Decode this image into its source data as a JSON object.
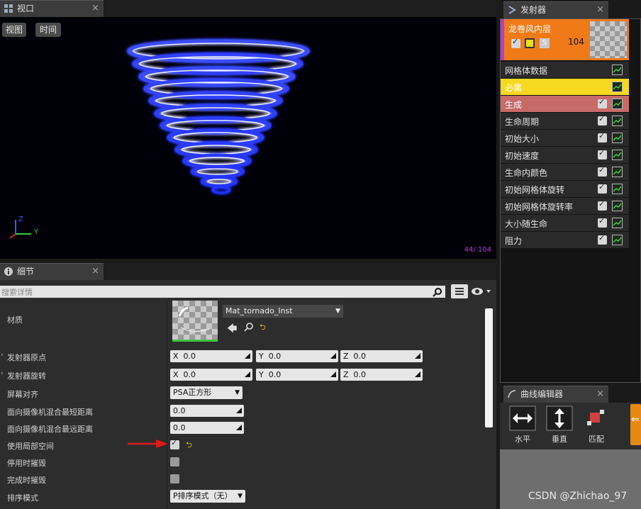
{
  "viewport": {
    "tab_label": "视口",
    "btn_view": "视图",
    "btn_time": "时间",
    "axis_z": "Z",
    "axis_y": "Y",
    "counter": "44/ 104"
  },
  "details": {
    "tab_label": "细节",
    "search_placeholder": "搜索详情",
    "material_label": "材质",
    "material_value": "Mat_tornado_Inst",
    "rows": {
      "origin": "发射器原点",
      "rotation": "发射器旋转",
      "screen_align": "屏幕对齐",
      "min_dist": "面向摄像机混合最短距离",
      "max_dist": "面向摄像机混合最远距离",
      "local_space": "使用局部空间",
      "kill_disabled": "停用时摧毁",
      "kill_complete": "完成时摧毁",
      "sort_mode": "排序模式"
    },
    "vec": {
      "x": "X",
      "y": "Y",
      "z": "Z",
      "xv": "0.0",
      "yv": "0.0",
      "zv": "0.0"
    },
    "screen_align_value": "PSA正方形",
    "min_dist_value": "0.0",
    "max_dist_value": "0.0",
    "sort_mode_value": "P排序模式（无）"
  },
  "emitters": {
    "tab_label": "发射器",
    "emitter_name": "龙卷风内层",
    "emitter_count": "104",
    "solo_label": "S",
    "modules": [
      {
        "label": "网格体数据"
      },
      {
        "label": "必需"
      },
      {
        "label": "生成"
      },
      {
        "label": "生命周期"
      },
      {
        "label": "初始大小"
      },
      {
        "label": "初始速度"
      },
      {
        "label": "生命内颜色"
      },
      {
        "label": "初始网格体旋转"
      },
      {
        "label": "初始网格体旋转率"
      },
      {
        "label": "大小随生命"
      },
      {
        "label": "阻力"
      }
    ]
  },
  "curve_editor": {
    "tab_label": "曲线编辑器",
    "btn_horizontal": "水平",
    "btn_vertical": "垂直",
    "btn_fit": "匹配"
  },
  "watermark": "CSDN @Zhichao_97",
  "colors": {
    "required": "#f5d81f",
    "spawn": "#c86a6a",
    "emitter_header": "#f07a18",
    "accent_purple": "#b23bd6"
  }
}
